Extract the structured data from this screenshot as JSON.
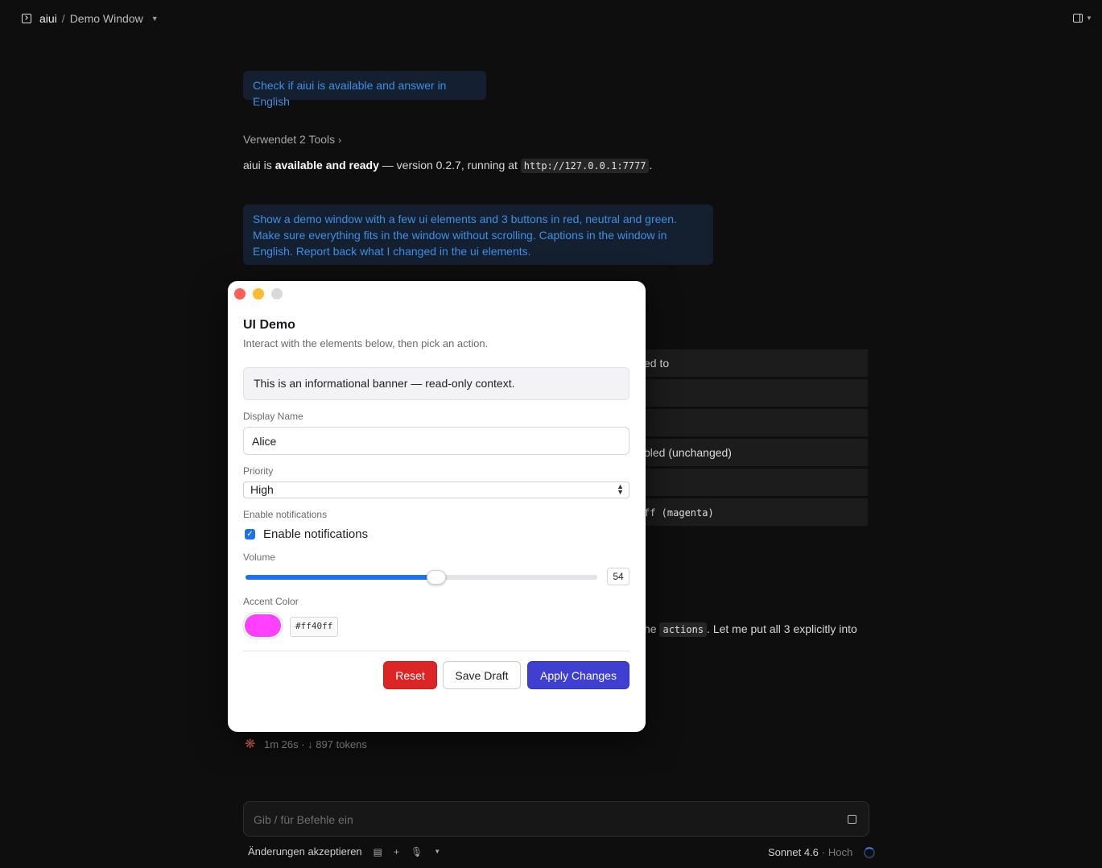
{
  "topbar": {
    "app_name": "aiui",
    "separator": "/",
    "window_name": "Demo Window"
  },
  "chat": {
    "user_message_1": "Check if aiui is available and answer in English",
    "tools_label": "Verwendet 2 Tools",
    "answer_prefix": "aiui is ",
    "answer_bold": "available and ready",
    "answer_middle": " — version 0.2.7, running at ",
    "answer_url": "http://127.0.0.1:7777",
    "answer_suffix": ".",
    "user_message_2": "Show a  demo window with a few ui elements and 3 buttons in red, neutral and green. Make sure everything fits in the window without scrolling. Captions in the window in English. Report back what I changed in the ui elements.",
    "table_rows": [
      "ed to",
      "",
      "",
      "bled (unchanged)",
      "",
      "ff  (magenta)"
    ],
    "trailing_prefix": "he ",
    "trailing_code": "actions",
    "trailing_suffix": ". Let me put all 3 explicitly into",
    "status_text": "1m 26s · ↓ 897 tokens"
  },
  "composer": {
    "placeholder": "Gib / für Befehle ein"
  },
  "bottombar": {
    "accept_label": "Änderungen akzeptieren",
    "model_name": "Sonnet 4.6",
    "model_effort": "· Hoch"
  },
  "modal": {
    "title": "UI Demo",
    "subtitle": "Interact with the elements below, then pick an action.",
    "banner": "This is an informational banner — read-only context.",
    "display_name_label": "Display Name",
    "display_name_value": "Alice",
    "priority_label": "Priority",
    "priority_value": "High",
    "notifications_label": "Enable notifications",
    "notifications_checkbox_label": "Enable notifications",
    "notifications_checked": true,
    "volume_label": "Volume",
    "volume_value": "54",
    "volume_fraction": 0.54,
    "accent_label": "Accent Color",
    "accent_hex": "#ff40ff",
    "reset_label": "Reset",
    "save_draft_label": "Save Draft",
    "apply_label": "Apply Changes"
  },
  "colors": {
    "reset": "#dc2626",
    "apply": "#3f3fd2",
    "accent": "#ff40ff",
    "user_bubble_text": "#3d8fe6",
    "user_bubble_bg": "#142030"
  }
}
